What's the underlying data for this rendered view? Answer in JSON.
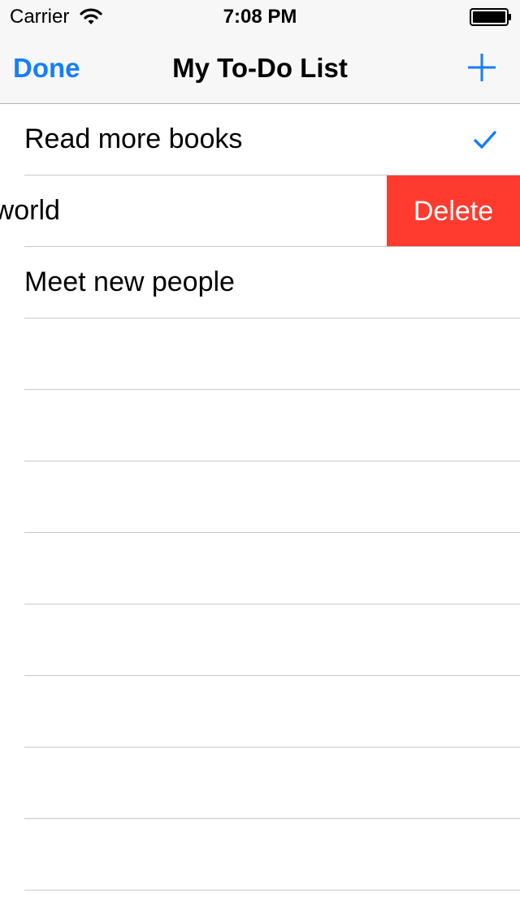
{
  "status_bar": {
    "carrier": "Carrier",
    "time": "7:08 PM",
    "icons": [
      "wifi-icon",
      "battery-icon"
    ]
  },
  "nav_bar": {
    "left_button": "Done",
    "title": "My To-Do List",
    "right_icon": "plus-icon"
  },
  "items": [
    {
      "label": "Read more books",
      "checked": true
    },
    {
      "label": "See the world",
      "checked": false,
      "swiped_to_delete": true
    },
    {
      "label": "Meet new people",
      "checked": false
    }
  ],
  "delete_action": {
    "label": "Delete",
    "color": "#ff3b30"
  },
  "colors": {
    "tint": "#157efb",
    "bar_background": "#f7f7f7",
    "separator": "#c8c7cc"
  }
}
